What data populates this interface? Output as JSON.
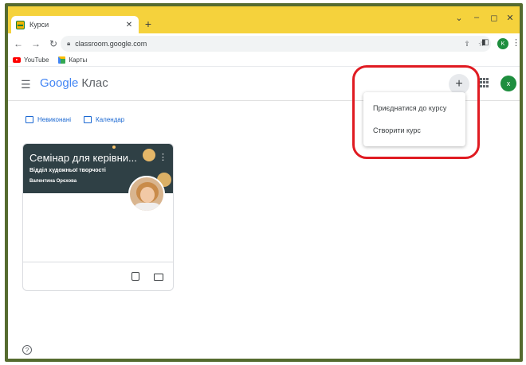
{
  "browser": {
    "tab_title": "Курси",
    "new_tab_glyph": "+",
    "url": "classroom.google.com",
    "bookmarks": [
      {
        "label": "YouTube"
      },
      {
        "label": "Карты"
      }
    ],
    "profile_initial": "K"
  },
  "classroom": {
    "logo_google": "Google",
    "logo_product": "Клас",
    "avatar_initial": "x",
    "links": [
      {
        "label": "Невиконані",
        "icon": "checklist-icon"
      },
      {
        "label": "Календар",
        "icon": "calendar-icon"
      }
    ],
    "card": {
      "title": "Семінар для керівни...",
      "section": "Відділ художньої творчості",
      "teacher": "Валентина Орєхова"
    },
    "menu": {
      "items": [
        "Приєднатися до курсу",
        "Створити курс"
      ]
    }
  },
  "colors": {
    "tabstrip": "#f5d23c",
    "card_banner": "#2f4045",
    "link_blue": "#1967d2",
    "highlight_red": "#e01b22",
    "avatar_green": "#1e8e3e"
  }
}
